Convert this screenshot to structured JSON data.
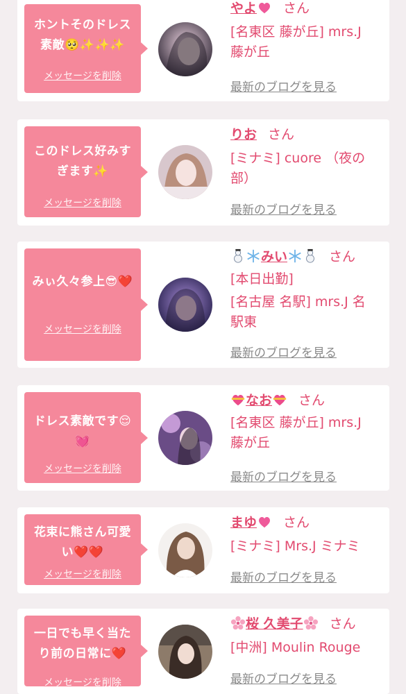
{
  "messages": [
    {
      "text": "ホントそのドレス素敵🥺✨✨✨",
      "delete_label": "メッセージを削除",
      "name": "やよ",
      "honorific": "さん",
      "shop": [
        "[名東区 藤が丘] mrs.J",
        "藤が丘"
      ],
      "blog_label": "最新のブログを見る"
    },
    {
      "text": "このドレス好みすぎます✨",
      "delete_label": "メッセージを削除",
      "name": "りお",
      "honorific": "さん",
      "shop": [
        "[ミナミ] cuore （夜の",
        "部）"
      ],
      "blog_label": "最新のブログを見る"
    },
    {
      "text": "みぃ久々参上😎❤️",
      "delete_label": "メッセージを削除",
      "name": "みい",
      "honorific": "さん",
      "shop": [
        "[本日出勤]",
        "[名古屋 名駅] mrs.J 名",
        "駅東"
      ],
      "blog_label": "最新のブログを見る"
    },
    {
      "text": "ドレス素敵です😌💓",
      "delete_label": "メッセージを削除",
      "name": "なお",
      "honorific": "さん",
      "shop": [
        "[名東区 藤が丘] mrs.J",
        "藤が丘"
      ],
      "blog_label": "最新のブログを見る"
    },
    {
      "text": "花束に熊さん可愛い❤️❤️",
      "delete_label": "メッセージを削除",
      "name": "まゆ",
      "honorific": "さん",
      "shop": [
        "[ミナミ] Mrs.J ミナミ"
      ],
      "blog_label": "最新のブログを見る"
    },
    {
      "text": "一日でも早く当たり前の日常に❤️",
      "delete_label": "メッセージを削除",
      "name": "桜 久美子",
      "honorific": "さん",
      "shop": [
        "[中洲] Moulin Rouge"
      ],
      "blog_label": "最新のブログを見る"
    }
  ],
  "colors": {
    "accent": "#e24a6f",
    "bubble": "#f5889b",
    "background": "#f3eef0",
    "card": "#ffffff",
    "link_gray": "#8a8a8a"
  }
}
